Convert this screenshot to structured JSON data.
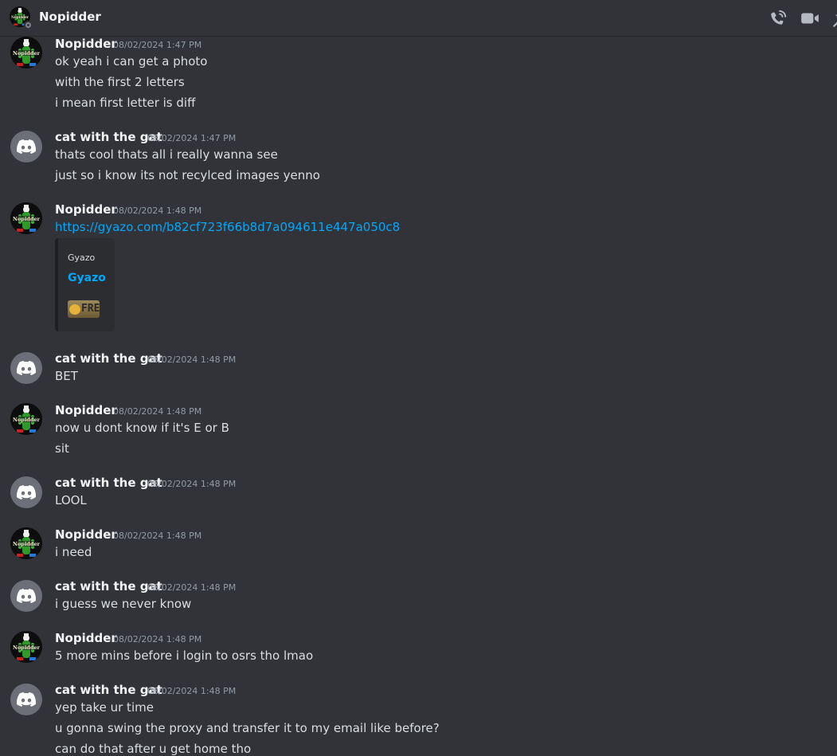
{
  "header": {
    "title": "Nopidder",
    "icons": [
      "voice-call-icon",
      "video-call-icon",
      "pin-icon"
    ]
  },
  "colors": {
    "background": "#313338",
    "link": "#00a8fc",
    "username": "#f2f3f5",
    "timestamp": "#949ba4",
    "discord_default_avatar": "#6d6f78"
  },
  "messages": [
    {
      "author": "Nopidder",
      "timestamp": "08/02/2024 1:47 PM",
      "lines": [
        "ok yeah i can get a photo",
        "with the first 2 letters",
        "i mean first letter is diff"
      ]
    },
    {
      "author": "cat with the gat",
      "timestamp": "08/02/2024 1:47 PM",
      "lines": [
        "thats cool thats all i really wanna see",
        "just so i know its not recylced images yenno"
      ]
    },
    {
      "author": "Nopidder",
      "timestamp": "08/02/2024 1:48 PM",
      "link": "https://gyazo.com/b82cf723f66b8d7a094611e447a050c8",
      "embed": {
        "provider": "Gyazo",
        "title": "Gyazo",
        "thumbnail_text": "FRE"
      }
    },
    {
      "author": "cat with the gat",
      "timestamp": "08/02/2024 1:48 PM",
      "lines": [
        "BET"
      ]
    },
    {
      "author": "Nopidder",
      "timestamp": "08/02/2024 1:48 PM",
      "lines": [
        "now u dont know if it's E or B",
        "sit"
      ]
    },
    {
      "author": "cat with the gat",
      "timestamp": "08/02/2024 1:48 PM",
      "lines": [
        "LOOL"
      ]
    },
    {
      "author": "Nopidder",
      "timestamp": "08/02/2024 1:48 PM",
      "lines": [
        "i need"
      ]
    },
    {
      "author": "cat with the gat",
      "timestamp": "08/02/2024 1:48 PM",
      "lines": [
        "i guess we never know"
      ]
    },
    {
      "author": "Nopidder",
      "timestamp": "08/02/2024 1:48 PM",
      "lines": [
        "5 more mins before i login to osrs tho lmao"
      ]
    },
    {
      "author": "cat with the gat",
      "timestamp": "08/02/2024 1:48 PM",
      "lines": [
        "yep take ur time",
        "u gonna swing the proxy and transfer it to my email like before?",
        "can do that after u get home tho"
      ]
    }
  ]
}
